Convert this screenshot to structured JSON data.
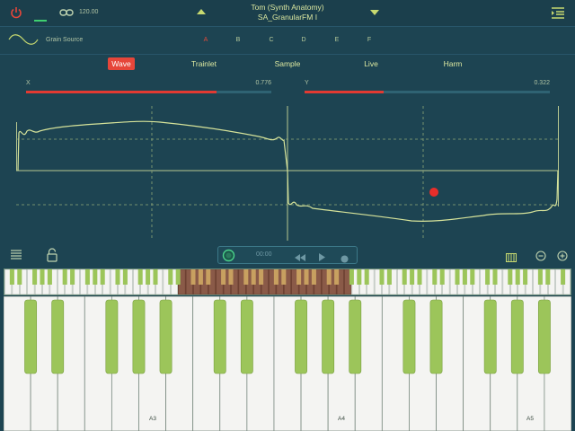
{
  "header": {
    "tempo": "120.00",
    "preset_title": "Tom (Synth Anatomy)",
    "preset_name": "SA_GranularFM I",
    "icons": [
      "power-icon",
      "link-icon",
      "prev-preset-icon",
      "next-preset-icon",
      "menu-icon"
    ]
  },
  "source": {
    "label": "Grain Source",
    "letters": [
      "A",
      "B",
      "C",
      "D",
      "E",
      "F"
    ],
    "active_letter": "A"
  },
  "tabs": {
    "items": [
      "Wave",
      "Trainlet",
      "Sample",
      "Live",
      "Harm"
    ],
    "active": "Wave"
  },
  "sliders": {
    "x": {
      "label": "X",
      "value": "0.776",
      "fill": 0.776
    },
    "y": {
      "label": "Y",
      "value": "0.322",
      "fill": 0.322
    }
  },
  "transport": {
    "time": "00:00",
    "icons": [
      "record-ring-icon",
      "rewind-icon",
      "play-icon",
      "record-dot-icon"
    ]
  },
  "keyboard": {
    "octave_labels": [
      "A3",
      "A4",
      "A5"
    ]
  },
  "colors": {
    "background": "#1d4452",
    "accent_red": "#e6463a",
    "wave_line": "#d6e39a",
    "key_green": "#9cc55a"
  }
}
